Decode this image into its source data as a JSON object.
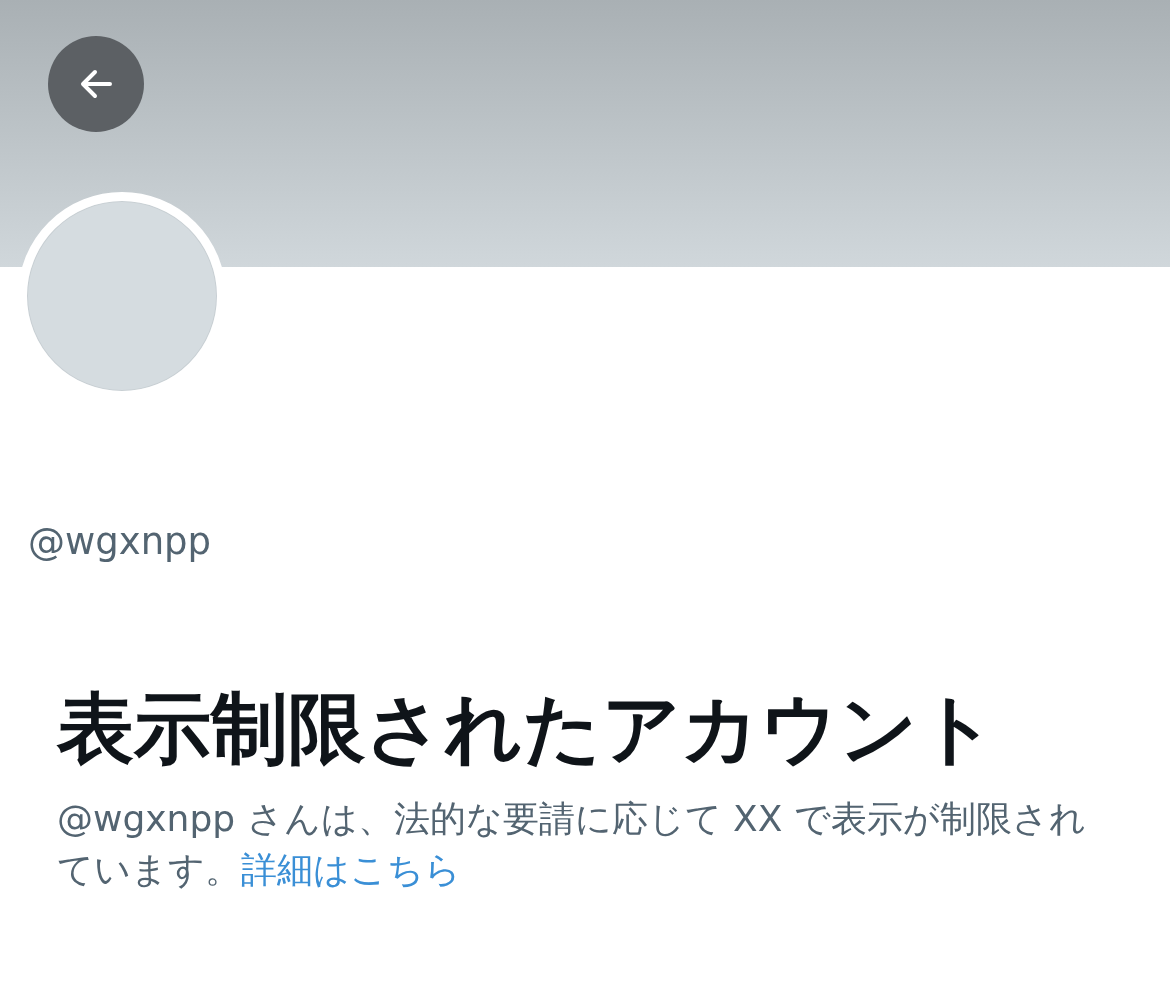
{
  "profile": {
    "handle": "@wgxnpp"
  },
  "notice": {
    "title": "表示制限されたアカウント",
    "text": "@wgxnpp さんは、法的な要請に応じて XX で表示が制限されています。",
    "link": "詳細はこちら"
  }
}
